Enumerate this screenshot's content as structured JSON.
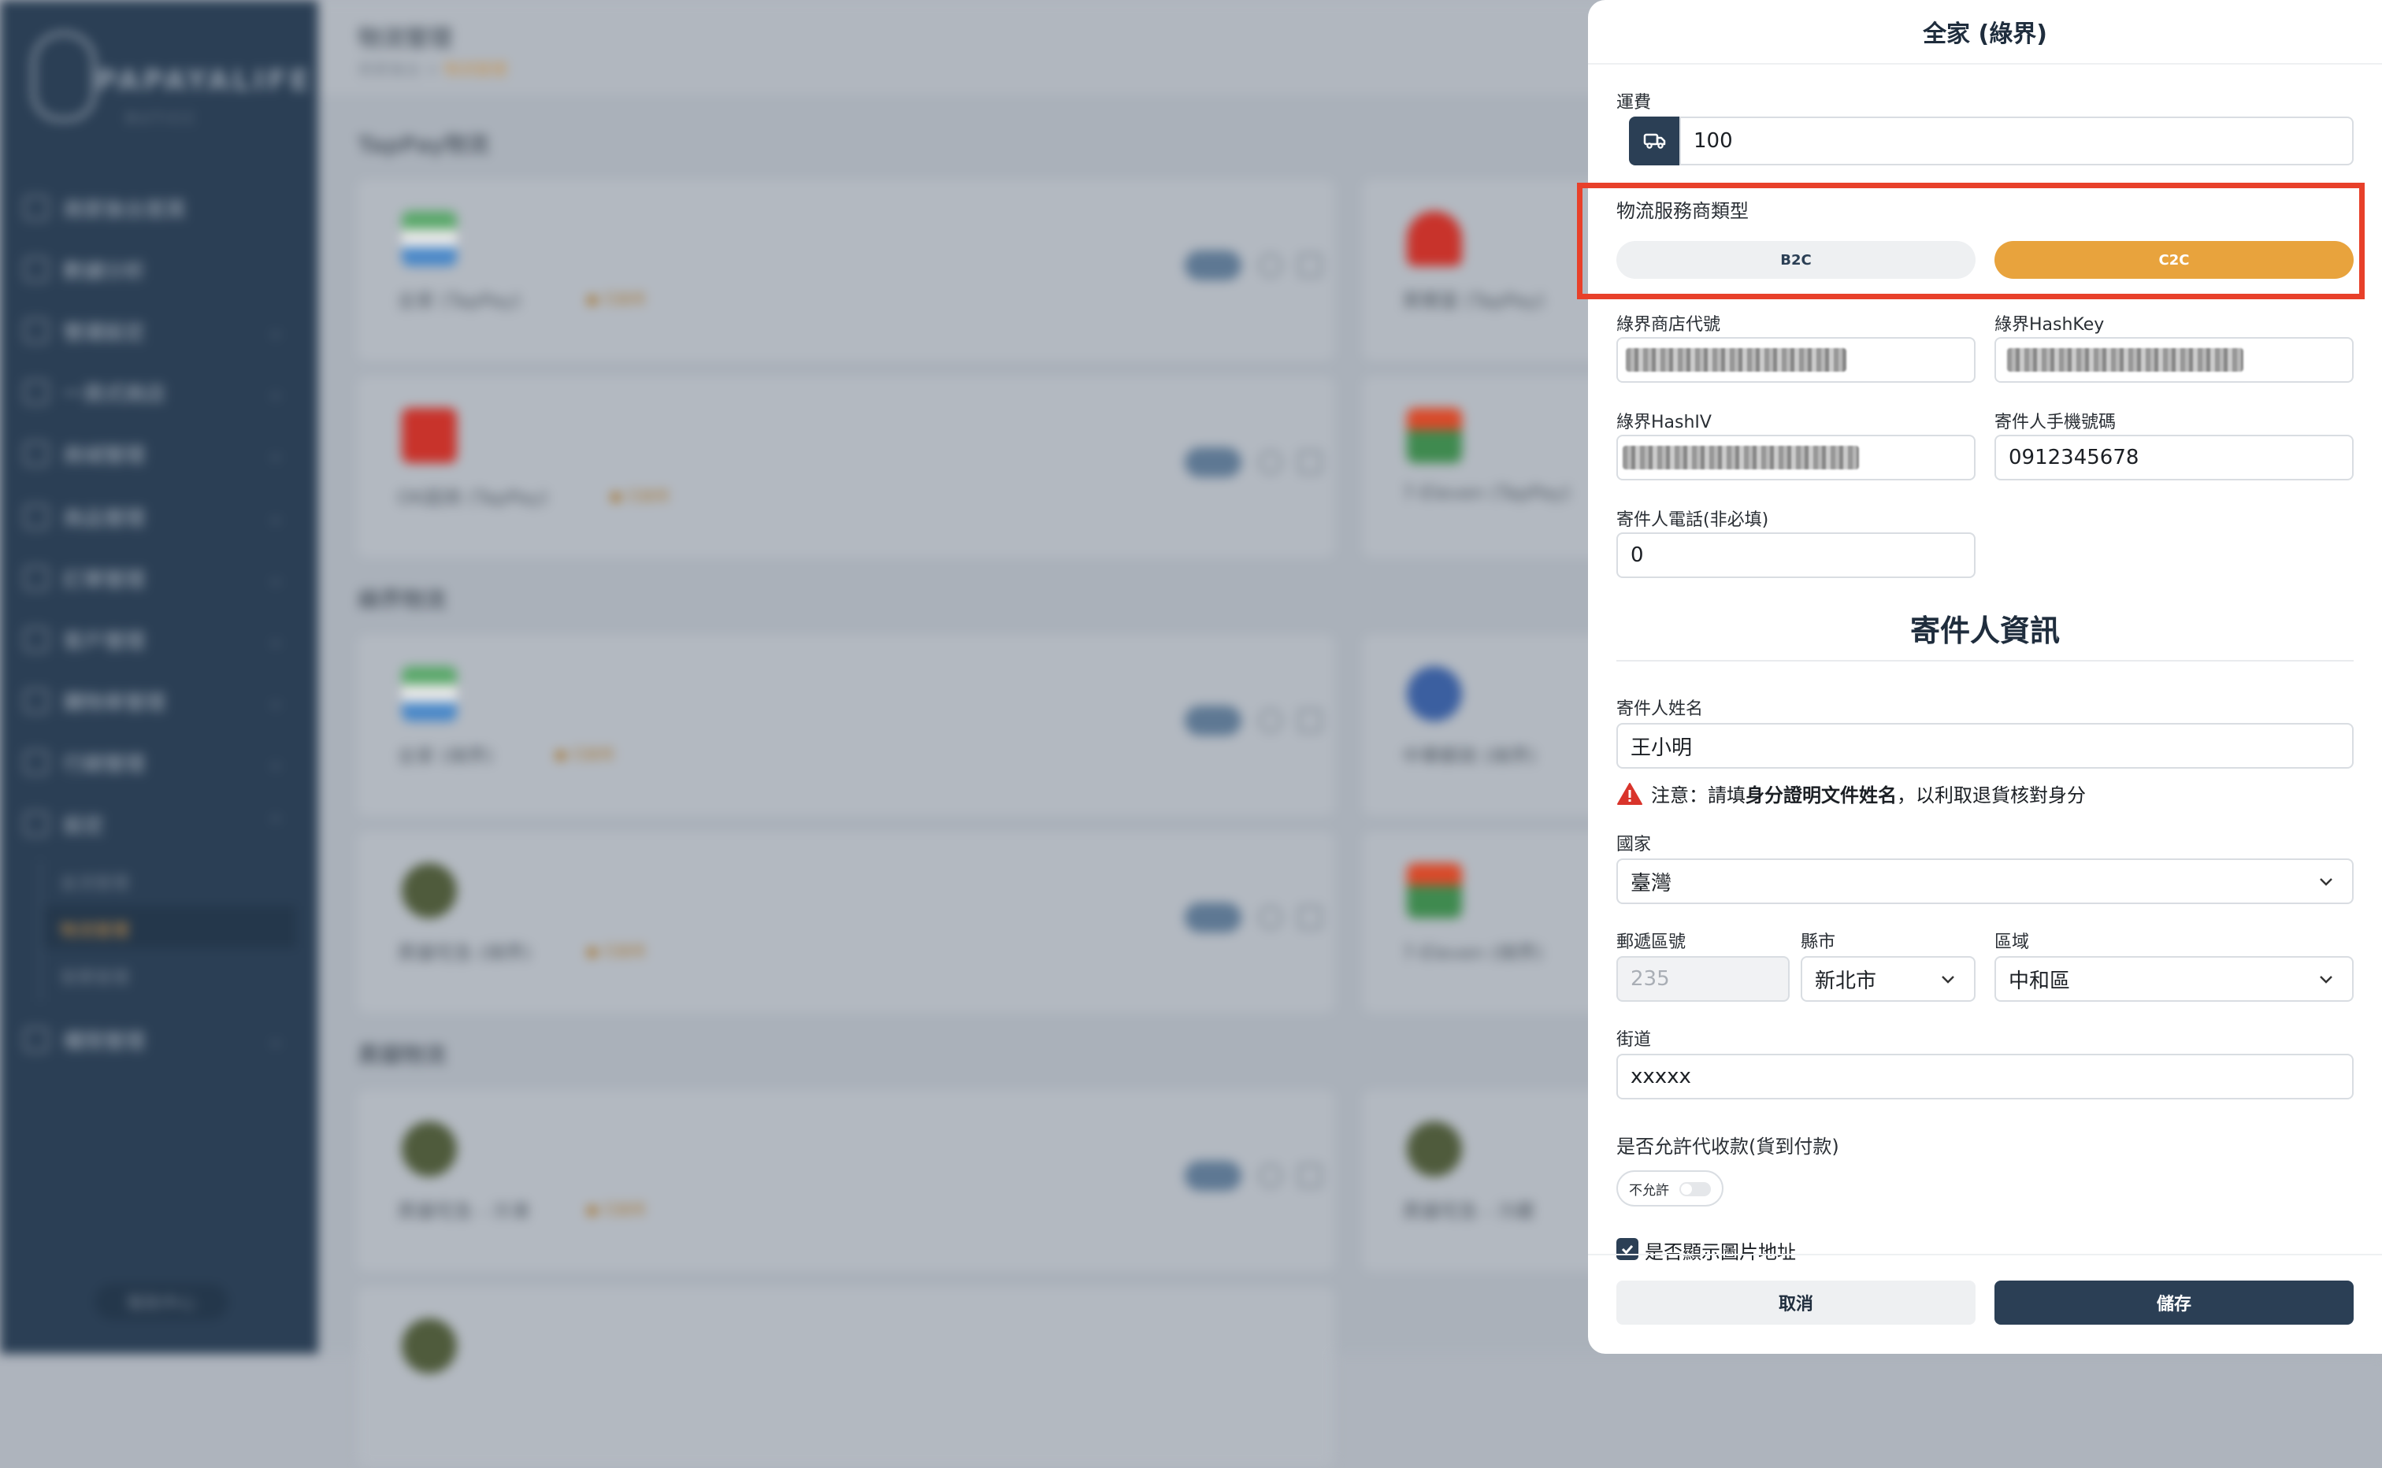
{
  "app": {
    "brand": "PAPAYALIFE",
    "brand_sub": "BUTICC",
    "help": "幫助中心"
  },
  "sidebar": {
    "items": [
      {
        "label": "商家後台首頁"
      },
      {
        "label": "數據分析"
      },
      {
        "label": "營運設定"
      },
      {
        "label": "一頁式商店"
      },
      {
        "label": "商城管理"
      },
      {
        "label": "商品管理"
      },
      {
        "label": "訂單管理"
      },
      {
        "label": "客戶管理"
      },
      {
        "label": "購物車管理"
      },
      {
        "label": "行銷管理"
      },
      {
        "label": "設定"
      },
      {
        "label": "權限管理"
      }
    ],
    "sub_items": [
      {
        "label": "金流管理"
      },
      {
        "label": "物流管理"
      },
      {
        "label": "發票管理"
      }
    ]
  },
  "page": {
    "title": "物流管理",
    "breadcrumb_home": "商家後台",
    "breadcrumb_sep": ">",
    "breadcrumb_current": "物流管理",
    "sections": [
      "TapPay物流",
      "綠界物流",
      "黑貓物流"
    ],
    "cards": [
      {
        "name": "全家 (TapPay)",
        "tag": "● 已啟用"
      },
      {
        "name": "萊爾富 (TapPay)",
        "tag": "● 已啟用"
      },
      {
        "name": "OK超商 (TapPay)",
        "tag": "● 已啟用"
      },
      {
        "name": "7-Eleven (TapPay)",
        "tag": "● 已啟用"
      },
      {
        "name": "全家 (綠界)",
        "tag": "● 已啟用"
      },
      {
        "name": "中華郵政 (綠界)",
        "tag": "● 已啟用"
      },
      {
        "name": "黑貓宅急 (綠界)",
        "tag": "● 已啟用"
      },
      {
        "name": "7-Eleven (綠界)",
        "tag": "● 已啟用"
      },
      {
        "name": "黑貓宅急 - 冷凍",
        "tag": "● 已啟用"
      },
      {
        "name": "黑貓宅急 - 冷藏",
        "tag": "● 已啟用"
      }
    ]
  },
  "panel": {
    "title": "全家 (綠界)",
    "shipping_label": "運費",
    "shipping_value": "100",
    "provider_type_label": "物流服務商類型",
    "provider_options": [
      "B2C",
      "C2C"
    ],
    "provider_selected": "C2C",
    "merchant_id_label": "綠界商店代號",
    "hashkey_label": "綠界HashKey",
    "hashiv_label": "綠界HashIV",
    "sender_mobile_label": "寄件人手機號碼",
    "sender_mobile_value": "0912345678",
    "sender_phone_label": "寄件人電話(非必填)",
    "sender_phone_value": "0",
    "sender_section_title": "寄件人資訊",
    "sender_name_label": "寄件人姓名",
    "sender_name_value": "王小明",
    "warning_prefix": "注意：請填",
    "warning_bold": "身分證明文件姓名",
    "warning_suffix": "，以利取退貨核對身分",
    "country_label": "國家",
    "country_value": "臺灣",
    "postcode_label": "郵遞區號",
    "postcode_value": "235",
    "city_label": "縣市",
    "city_value": "新北市",
    "district_label": "區域",
    "district_value": "中和區",
    "street_label": "街道",
    "street_value": "xxxxx",
    "cod_label": "是否允許代收款(貨到付款)",
    "cod_toggle_text": "不允許",
    "cod_enabled": false,
    "show_image_label": "是否顯示圖片地址",
    "show_image_checked": true,
    "cancel_label": "取消",
    "save_label": "儲存"
  },
  "colors": {
    "accent": "#e8a33d",
    "navy": "#2b3f55",
    "highlight": "#e8402a",
    "warning": "#d9342b"
  }
}
